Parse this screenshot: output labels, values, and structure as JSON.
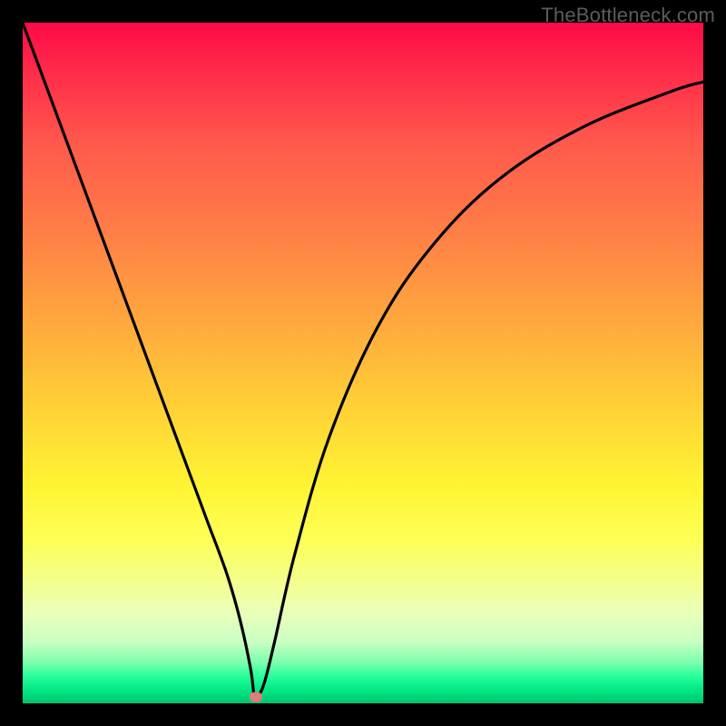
{
  "watermark": "TheBottleneck.com",
  "chart_data": {
    "type": "line",
    "title": "",
    "xlabel": "",
    "ylabel": "",
    "xlim": [
      0,
      100
    ],
    "ylim": [
      0,
      100
    ],
    "grid": false,
    "legend": false,
    "series": [
      {
        "name": "bottleneck-curve",
        "x": [
          0,
          5,
          10,
          15,
          20,
          24,
          27,
          30,
          32,
          33.5,
          34,
          34.5,
          35.5,
          37,
          40,
          45,
          52,
          60,
          70,
          82,
          95,
          100
        ],
        "y": [
          100,
          86.5,
          73,
          59.5,
          46,
          35.2,
          27.1,
          19,
          12,
          5,
          1.2,
          1.0,
          3,
          9,
          22,
          39,
          55,
          67,
          77,
          84.5,
          89.8,
          91.3
        ]
      }
    ],
    "markers": [
      {
        "name": "vertex-dot",
        "x": 34.3,
        "y": 1.0,
        "color": "#e37a7e"
      }
    ],
    "background_gradient": {
      "direction": "vertical",
      "stops": [
        {
          "pos": 0.0,
          "color": "#ff0a46"
        },
        {
          "pos": 0.3,
          "color": "#ff7c47"
        },
        {
          "pos": 0.68,
          "color": "#fff433"
        },
        {
          "pos": 0.91,
          "color": "#c9ffc3"
        },
        {
          "pos": 1.0,
          "color": "#00c56e"
        }
      ]
    }
  }
}
